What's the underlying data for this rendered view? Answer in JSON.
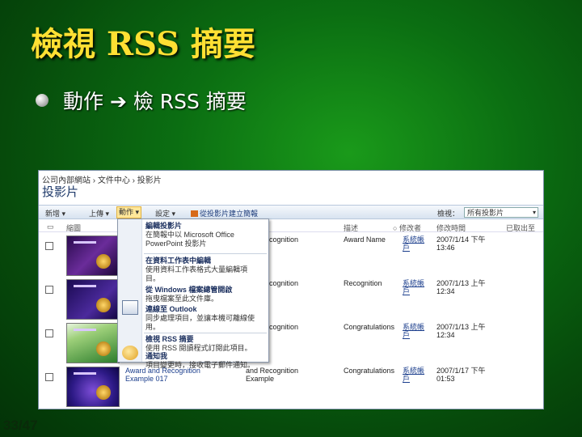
{
  "slide": {
    "title": "檢視 RSS 摘要",
    "bullet": "動作 ➔ 檢 RSS 摘要",
    "slide_number": "33/47"
  },
  "screenshot": {
    "breadcrumb": "公司內部網站 › 文件中心 › 投影片",
    "library_title": "投影片",
    "toolbar": {
      "new": "新增 ▾",
      "upload": "上傳 ▾",
      "actions": "動作 ▾",
      "settings": "設定 ▾",
      "create_deck": "從投影片建立簡報",
      "view_label": "檢視：",
      "view_value": "所有投影片"
    },
    "columns": [
      "縮圖",
      "描述",
      "修改者",
      "修改時間",
      "已取出至"
    ],
    "rows": [
      {
        "category": "and Recognition",
        "description": "Award Name",
        "modified_by": "系統帳\n戶",
        "modified": "2007/1/14 下午\n13:46"
      },
      {
        "category": "and Recognition",
        "description": "Recognition",
        "modified_by": "系統帳\n戶",
        "modified": "2007/1/13 上午\n12:34"
      },
      {
        "category": "and Recognition",
        "description": "Congratulations",
        "modified_by": "系統帳\n戶",
        "modified": "2007/1/13 上午\n12:34"
      },
      {
        "name": "Award and Recognition\nExample 017",
        "category": "and Recognition\nExample",
        "description": "Congratulations",
        "modified_by": "系統帳\n戶",
        "modified": "2007/1/17 下午\n01:53"
      }
    ],
    "menu": [
      {
        "title": "編輯投影片",
        "desc": "在簡報中以 Microsoft Office\nPowerPoint 投影片"
      },
      {
        "title": "在資料工作表中編輯",
        "desc": "使用資料工作表格式大量編輯項\n目。"
      },
      {
        "title": "從 Windows 檔案總管開啟",
        "desc": "拖曳檔案至此文件庫。"
      },
      {
        "title": "連線至 Outlook",
        "desc": "同步處理項目，並讓本機可離線使\n用。"
      },
      {
        "title": "檢視 RSS 摘要",
        "desc": "使用 RSS 閱讀程式訂閱此項目。"
      },
      {
        "title": "通知我",
        "desc": "項目變更時，接收電子郵件通知。"
      }
    ]
  }
}
